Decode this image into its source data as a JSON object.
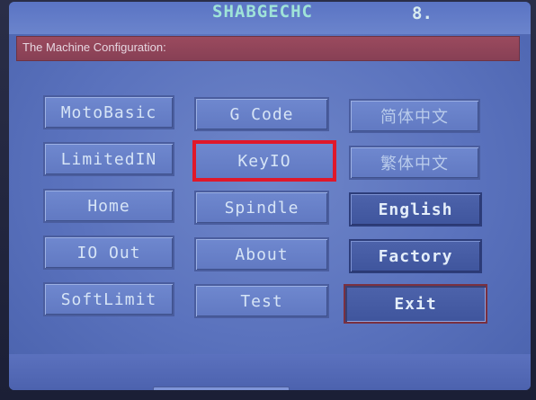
{
  "header": {
    "brand": "SHABGECHC",
    "indicator": "8."
  },
  "title": "The Machine Configuration:",
  "buttons": {
    "col1": [
      "MotoBasic",
      "LimitedIN",
      "Home",
      "IO Out",
      "SoftLimit"
    ],
    "col2": [
      "G Code",
      "KeyIO",
      "Spindle",
      "About",
      "Test"
    ],
    "col3": [
      "简体中文",
      "繁体中文",
      "English",
      "Factory",
      "Exit"
    ]
  },
  "highlighted_button": "KeyIO",
  "colors": {
    "screen": "#5a72bd",
    "title_bar": "#9b4a5e",
    "highlight": "#e0182a"
  }
}
